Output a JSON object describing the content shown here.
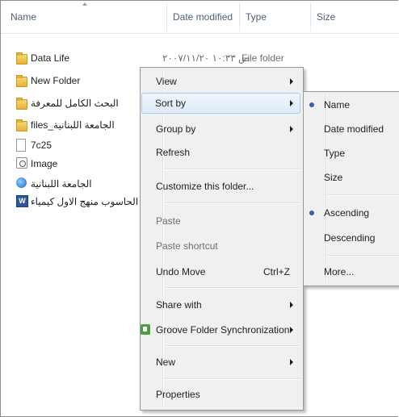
{
  "columns": {
    "name": "Name",
    "date_modified": "Date modified",
    "type": "Type",
    "size": "Size"
  },
  "files": [
    {
      "name": "Data Life",
      "icon": "folder-icon",
      "date": "۲۰۰۷/۱۱/۲۰ ص ۱۰:۳۳",
      "type": "File folder"
    },
    {
      "name": "New Folder",
      "icon": "folder-icon"
    },
    {
      "name": "البحث الكامل للمعرفة",
      "icon": "folder-icon"
    },
    {
      "name": "files_الجامعة اللبنانية",
      "icon": "folder-icon"
    },
    {
      "name": "7c25",
      "icon": "file-icon"
    },
    {
      "name": "Image",
      "icon": "image-file-icon"
    },
    {
      "name": "الجامعة اللبنانية",
      "icon": "internet-explorer-icon"
    },
    {
      "name": "الحاسوب منهج الاول كيمياء",
      "icon": "word-document-icon"
    }
  ],
  "context_menu": {
    "view": "View",
    "sort_by": "Sort by",
    "group_by": "Group by",
    "refresh": "Refresh",
    "customize": "Customize this folder...",
    "paste": "Paste",
    "paste_shortcut": "Paste shortcut",
    "undo_move": "Undo Move",
    "undo_shortcut": "Ctrl+Z",
    "share_with": "Share with",
    "groove": "Groove Folder Synchronization",
    "new": "New",
    "properties": "Properties"
  },
  "sort_submenu": {
    "name": "Name",
    "date_modified": "Date modified",
    "type": "Type",
    "size": "Size",
    "ascending": "Ascending",
    "descending": "Descending",
    "more": "More...",
    "selected_field": "Name",
    "selected_order": "Ascending"
  },
  "colors": {
    "header_text": "#4c607a",
    "highlight_border": "#a8c8ec",
    "bullet": "#3b5ea8"
  }
}
